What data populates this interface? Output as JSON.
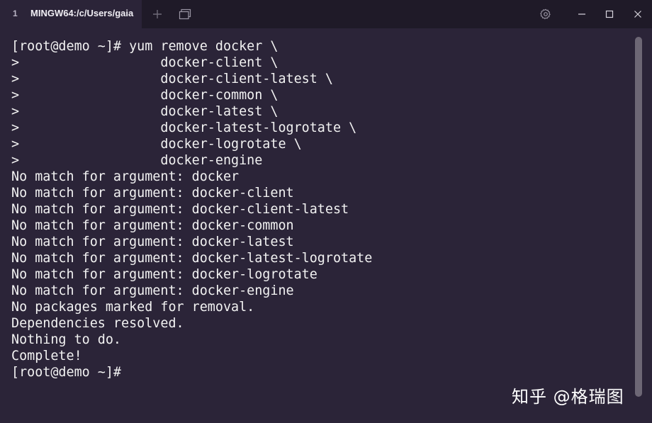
{
  "tab": {
    "index": "1",
    "title": "MINGW64:/c/Users/gaia"
  },
  "icons": {
    "new_tab": "plus-icon",
    "split": "split-pane-icon",
    "settings": "gear-icon",
    "minimize": "minimize-icon",
    "maximize": "maximize-icon",
    "close": "close-icon"
  },
  "colors": {
    "background": "#2b2438",
    "titlebar": "#1f1a28",
    "text": "#f2f2f2",
    "scrollbar": "#6d6775"
  },
  "terminal": {
    "lines": [
      "[root@demo ~]# yum remove docker \\",
      ">                  docker-client \\",
      ">                  docker-client-latest \\",
      ">                  docker-common \\",
      ">                  docker-latest \\",
      ">                  docker-latest-logrotate \\",
      ">                  docker-logrotate \\",
      ">                  docker-engine",
      "No match for argument: docker",
      "No match for argument: docker-client",
      "No match for argument: docker-client-latest",
      "No match for argument: docker-common",
      "No match for argument: docker-latest",
      "No match for argument: docker-latest-logrotate",
      "No match for argument: docker-logrotate",
      "No match for argument: docker-engine",
      "No packages marked for removal.",
      "Dependencies resolved.",
      "Nothing to do.",
      "Complete!",
      "[root@demo ~]#"
    ]
  },
  "watermark": {
    "text": "知乎 @格瑞图"
  }
}
